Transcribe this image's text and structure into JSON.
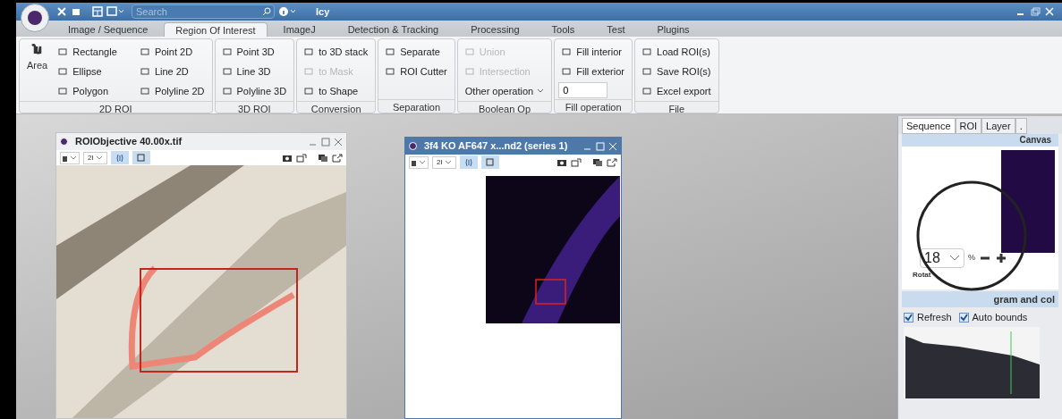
{
  "app": {
    "title": "Icy",
    "search_placeholder": "Search"
  },
  "menu_tabs": [
    {
      "label": "Image / Sequence",
      "selected": false
    },
    {
      "label": "Region Of Interest",
      "selected": true
    },
    {
      "label": "ImageJ",
      "selected": false
    },
    {
      "label": "Detection & Tracking",
      "selected": false
    },
    {
      "label": "Processing",
      "selected": false
    },
    {
      "label": "Tools",
      "selected": false
    },
    {
      "label": "Test",
      "selected": false
    },
    {
      "label": "Plugins",
      "selected": false
    }
  ],
  "ribbon_groups": [
    {
      "title": "2D ROI",
      "big": {
        "label": "Area"
      },
      "items": [
        {
          "label": "Rectangle",
          "disabled": false
        },
        {
          "label": "Point 2D",
          "disabled": false
        },
        {
          "label": "Ellipse",
          "disabled": false
        },
        {
          "label": "Line 2D",
          "disabled": false
        },
        {
          "label": "Polygon",
          "disabled": false
        },
        {
          "label": "Polyline 2D",
          "disabled": false
        }
      ]
    },
    {
      "title": "3D ROI",
      "items": [
        {
          "label": "Point 3D",
          "disabled": false
        },
        {
          "label": "Line 3D",
          "disabled": false
        },
        {
          "label": "Polyline 3D",
          "disabled": false
        }
      ]
    },
    {
      "title": "Conversion",
      "items": [
        {
          "label": "to 3D stack",
          "disabled": false
        },
        {
          "label": "to Mask",
          "disabled": true
        },
        {
          "label": "to Shape",
          "disabled": false
        }
      ]
    },
    {
      "title": "Separation",
      "items": [
        {
          "label": "Separate",
          "disabled": false
        },
        {
          "label": "ROI Cutter",
          "disabled": false
        }
      ]
    },
    {
      "title": "Boolean Op",
      "items": [
        {
          "label": "Union",
          "disabled": true
        },
        {
          "label": "Intersection",
          "disabled": true
        }
      ],
      "dropdown": "Other operation"
    },
    {
      "title": "Fill operation",
      "items": [
        {
          "label": "Fill interior",
          "disabled": false
        },
        {
          "label": "Fill exterior",
          "disabled": false
        }
      ],
      "value": "0"
    },
    {
      "title": "File",
      "items": [
        {
          "label": "Load ROI(s)",
          "disabled": false
        },
        {
          "label": "Save ROI(s)",
          "disabled": false
        },
        {
          "label": "Excel export",
          "disabled": false
        }
      ]
    }
  ],
  "image_windows": [
    {
      "title": "ROIObjective 40.00x.tif",
      "canvas": "2I",
      "kind": "brightfield"
    },
    {
      "title": "3f4 KO AF647 x...nd2 (series 1)",
      "canvas": "2I",
      "kind": "fluorescence"
    }
  ],
  "inspector": {
    "tabs": [
      {
        "label": "Sequence",
        "selected": true
      },
      {
        "label": "ROI",
        "selected": false
      },
      {
        "label": "Layer",
        "selected": false
      },
      {
        "label": ".",
        "selected": false
      }
    ],
    "canvas_section": "Canvas",
    "zoom": "18",
    "zoom_unit": "%",
    "rotation_label": "Rotat",
    "histogram_section": "gram and col",
    "checkboxes": [
      {
        "label": "Refresh",
        "checked": true
      },
      {
        "label": "Auto bounds",
        "checked": true
      }
    ]
  }
}
